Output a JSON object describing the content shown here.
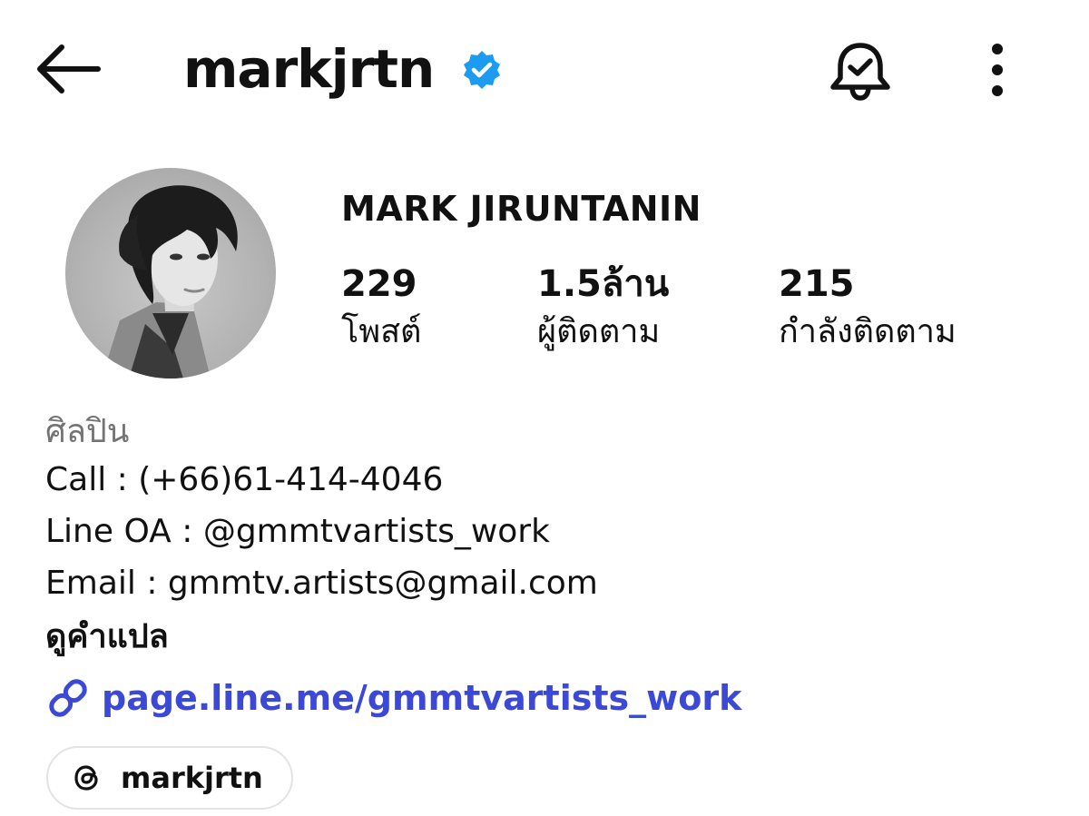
{
  "header": {
    "username": "markjrtn",
    "back_icon": "arrow-left-icon",
    "verified_icon": "verified-badge-icon",
    "bell_icon": "bell-check-icon",
    "more_icon": "more-vertical-icon"
  },
  "profile": {
    "full_name": "MARK JIRUNTANIN",
    "avatar": "profile-photo"
  },
  "stats": {
    "posts": {
      "value": "229",
      "label": "โพสต์"
    },
    "followers": {
      "value": "1.5ล้าน",
      "label": "ผู้ติดตาม"
    },
    "following": {
      "value": "215",
      "label": "กำลังติดตาม"
    }
  },
  "bio": {
    "category": "ศิลปิน",
    "line1": "Call : (+66)61-414-4046",
    "line2": "Line OA : @gmmtvartists_work",
    "line3": "Email : gmmtv.artists@gmail.com",
    "translate": "ดูคำแปล"
  },
  "link": {
    "text": "page.line.me/gmmtvartists_work",
    "icon": "link-icon"
  },
  "threads": {
    "label": "markjrtn",
    "icon": "threads-icon"
  },
  "colors": {
    "verified": "#1d9bf0",
    "link": "#3b49d6",
    "category": "#737373",
    "text": "#111111"
  }
}
